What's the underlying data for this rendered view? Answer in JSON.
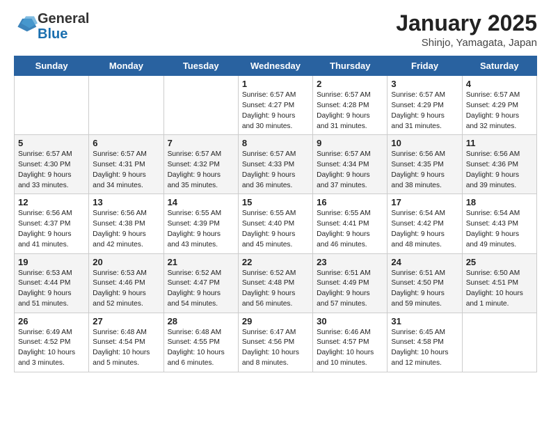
{
  "header": {
    "logo_general": "General",
    "logo_blue": "Blue",
    "month": "January 2025",
    "location": "Shinjo, Yamagata, Japan"
  },
  "weekdays": [
    "Sunday",
    "Monday",
    "Tuesday",
    "Wednesday",
    "Thursday",
    "Friday",
    "Saturday"
  ],
  "weeks": [
    [
      {
        "day": "",
        "info": ""
      },
      {
        "day": "",
        "info": ""
      },
      {
        "day": "",
        "info": ""
      },
      {
        "day": "1",
        "info": "Sunrise: 6:57 AM\nSunset: 4:27 PM\nDaylight: 9 hours\nand 30 minutes."
      },
      {
        "day": "2",
        "info": "Sunrise: 6:57 AM\nSunset: 4:28 PM\nDaylight: 9 hours\nand 31 minutes."
      },
      {
        "day": "3",
        "info": "Sunrise: 6:57 AM\nSunset: 4:29 PM\nDaylight: 9 hours\nand 31 minutes."
      },
      {
        "day": "4",
        "info": "Sunrise: 6:57 AM\nSunset: 4:29 PM\nDaylight: 9 hours\nand 32 minutes."
      }
    ],
    [
      {
        "day": "5",
        "info": "Sunrise: 6:57 AM\nSunset: 4:30 PM\nDaylight: 9 hours\nand 33 minutes."
      },
      {
        "day": "6",
        "info": "Sunrise: 6:57 AM\nSunset: 4:31 PM\nDaylight: 9 hours\nand 34 minutes."
      },
      {
        "day": "7",
        "info": "Sunrise: 6:57 AM\nSunset: 4:32 PM\nDaylight: 9 hours\nand 35 minutes."
      },
      {
        "day": "8",
        "info": "Sunrise: 6:57 AM\nSunset: 4:33 PM\nDaylight: 9 hours\nand 36 minutes."
      },
      {
        "day": "9",
        "info": "Sunrise: 6:57 AM\nSunset: 4:34 PM\nDaylight: 9 hours\nand 37 minutes."
      },
      {
        "day": "10",
        "info": "Sunrise: 6:56 AM\nSunset: 4:35 PM\nDaylight: 9 hours\nand 38 minutes."
      },
      {
        "day": "11",
        "info": "Sunrise: 6:56 AM\nSunset: 4:36 PM\nDaylight: 9 hours\nand 39 minutes."
      }
    ],
    [
      {
        "day": "12",
        "info": "Sunrise: 6:56 AM\nSunset: 4:37 PM\nDaylight: 9 hours\nand 41 minutes."
      },
      {
        "day": "13",
        "info": "Sunrise: 6:56 AM\nSunset: 4:38 PM\nDaylight: 9 hours\nand 42 minutes."
      },
      {
        "day": "14",
        "info": "Sunrise: 6:55 AM\nSunset: 4:39 PM\nDaylight: 9 hours\nand 43 minutes."
      },
      {
        "day": "15",
        "info": "Sunrise: 6:55 AM\nSunset: 4:40 PM\nDaylight: 9 hours\nand 45 minutes."
      },
      {
        "day": "16",
        "info": "Sunrise: 6:55 AM\nSunset: 4:41 PM\nDaylight: 9 hours\nand 46 minutes."
      },
      {
        "day": "17",
        "info": "Sunrise: 6:54 AM\nSunset: 4:42 PM\nDaylight: 9 hours\nand 48 minutes."
      },
      {
        "day": "18",
        "info": "Sunrise: 6:54 AM\nSunset: 4:43 PM\nDaylight: 9 hours\nand 49 minutes."
      }
    ],
    [
      {
        "day": "19",
        "info": "Sunrise: 6:53 AM\nSunset: 4:44 PM\nDaylight: 9 hours\nand 51 minutes."
      },
      {
        "day": "20",
        "info": "Sunrise: 6:53 AM\nSunset: 4:46 PM\nDaylight: 9 hours\nand 52 minutes."
      },
      {
        "day": "21",
        "info": "Sunrise: 6:52 AM\nSunset: 4:47 PM\nDaylight: 9 hours\nand 54 minutes."
      },
      {
        "day": "22",
        "info": "Sunrise: 6:52 AM\nSunset: 4:48 PM\nDaylight: 9 hours\nand 56 minutes."
      },
      {
        "day": "23",
        "info": "Sunrise: 6:51 AM\nSunset: 4:49 PM\nDaylight: 9 hours\nand 57 minutes."
      },
      {
        "day": "24",
        "info": "Sunrise: 6:51 AM\nSunset: 4:50 PM\nDaylight: 9 hours\nand 59 minutes."
      },
      {
        "day": "25",
        "info": "Sunrise: 6:50 AM\nSunset: 4:51 PM\nDaylight: 10 hours\nand 1 minute."
      }
    ],
    [
      {
        "day": "26",
        "info": "Sunrise: 6:49 AM\nSunset: 4:52 PM\nDaylight: 10 hours\nand 3 minutes."
      },
      {
        "day": "27",
        "info": "Sunrise: 6:48 AM\nSunset: 4:54 PM\nDaylight: 10 hours\nand 5 minutes."
      },
      {
        "day": "28",
        "info": "Sunrise: 6:48 AM\nSunset: 4:55 PM\nDaylight: 10 hours\nand 6 minutes."
      },
      {
        "day": "29",
        "info": "Sunrise: 6:47 AM\nSunset: 4:56 PM\nDaylight: 10 hours\nand 8 minutes."
      },
      {
        "day": "30",
        "info": "Sunrise: 6:46 AM\nSunset: 4:57 PM\nDaylight: 10 hours\nand 10 minutes."
      },
      {
        "day": "31",
        "info": "Sunrise: 6:45 AM\nSunset: 4:58 PM\nDaylight: 10 hours\nand 12 minutes."
      },
      {
        "day": "",
        "info": ""
      }
    ]
  ]
}
